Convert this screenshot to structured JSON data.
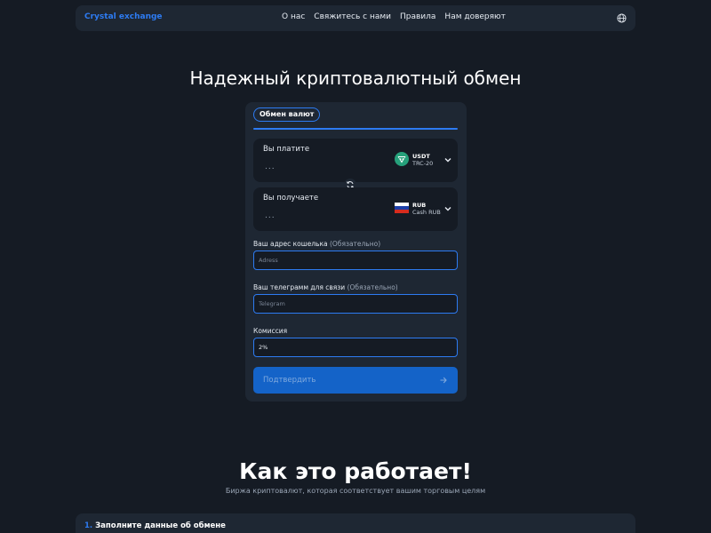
{
  "header": {
    "brand": "Crystal exchange",
    "nav": [
      "О нас",
      "Свяжитесь с нами",
      "Правила",
      "Нам доверяют"
    ],
    "language_icon": "globe-icon"
  },
  "hero": {
    "title": "Надежный криптовалютный обмен"
  },
  "exchange": {
    "tab": "Обмен валют",
    "pay": {
      "label": "Вы платите",
      "amount": "...",
      "currency_code": "USDT",
      "currency_network": "TRC-20",
      "icon": "tether-icon"
    },
    "receive": {
      "label": "Вы получаете",
      "amount": "...",
      "currency_code": "RUB",
      "currency_network": "Cash RUB",
      "icon": "russia-flag-icon"
    },
    "wallet": {
      "label": "Ваш адрес кошелька",
      "optional": "(Обязательно)",
      "placeholder": "Adress"
    },
    "telegram": {
      "label": "Ваш телеграмм для связи",
      "optional": "(Обязательно)",
      "placeholder": "Telegram"
    },
    "commission": {
      "label": "Комиссия",
      "value": "2%"
    },
    "submit_label": "Подтвердить"
  },
  "how": {
    "title": "Как это работает!",
    "subtitle": "Биржа криптовалют, которая соответствует вашим торговым целям",
    "step_number": "1.",
    "step_title": "Заполните данные об обмене"
  },
  "colors": {
    "background": "#151b24",
    "panel": "#1e2733",
    "accent": "#2d7bf2",
    "button": "#1463c8",
    "tether": "#26a17b"
  }
}
